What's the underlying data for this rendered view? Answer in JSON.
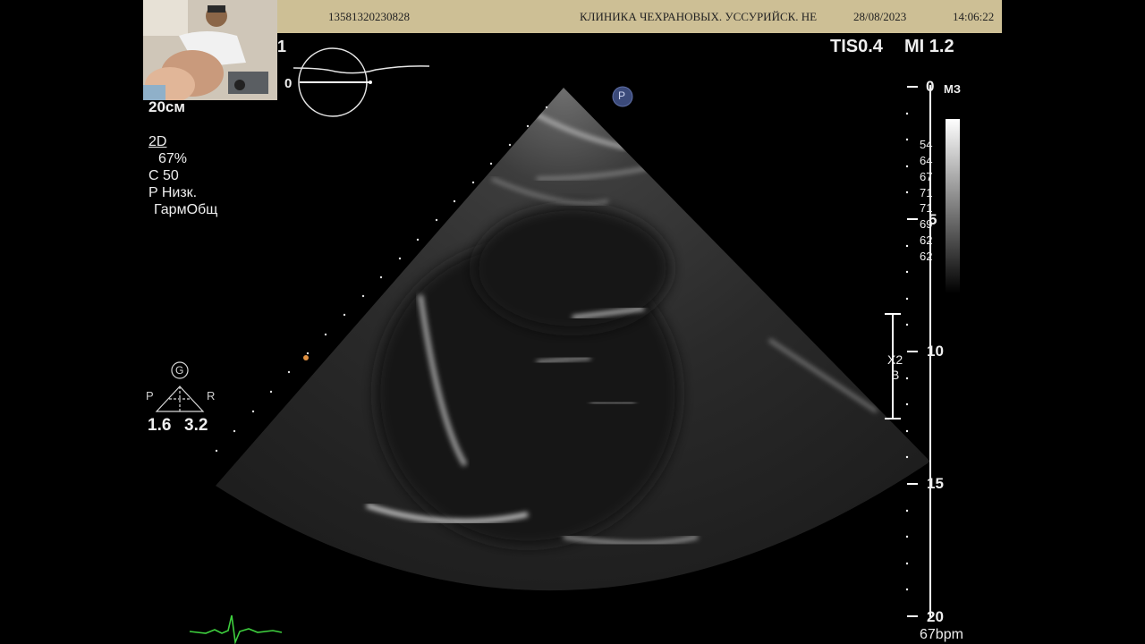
{
  "header": {
    "patient_id": "13581320230828",
    "clinic": "КЛИНИКА ЧЕХРАНОВЫХ. УССУРИЙСК. НЕ",
    "date": "28/08/2023",
    "time": "14:06:22"
  },
  "acoustic": {
    "tis": "TIS0.4",
    "mi": "MI 1.2"
  },
  "depth_field": "20см",
  "mode": {
    "name": "2D",
    "gain": "67%",
    "compression": "C 50",
    "power": "P Низк.",
    "harmonic": "ГармОбщ"
  },
  "probe": {
    "marker": "P",
    "orientation_letter": "G",
    "left_label": "P",
    "right_label": "R",
    "focus_left": "1.6",
    "focus_right": "3.2"
  },
  "frequency_unit": "МЗ",
  "greyscale_values": [
    "54",
    "64",
    "67",
    "71",
    "71",
    "69",
    "62",
    "62"
  ],
  "depth_scale": {
    "labels": [
      "0",
      "5",
      "10",
      "15",
      "20"
    ]
  },
  "zoom_box": {
    "factor": "X2",
    "label": "B"
  },
  "heart_rate": "67bpm",
  "trace_zero": "0",
  "truncated_label": "1",
  "colors": {
    "header_bg": "#cdbf95",
    "ecg": "#3ecf3e",
    "background": "#000000"
  }
}
